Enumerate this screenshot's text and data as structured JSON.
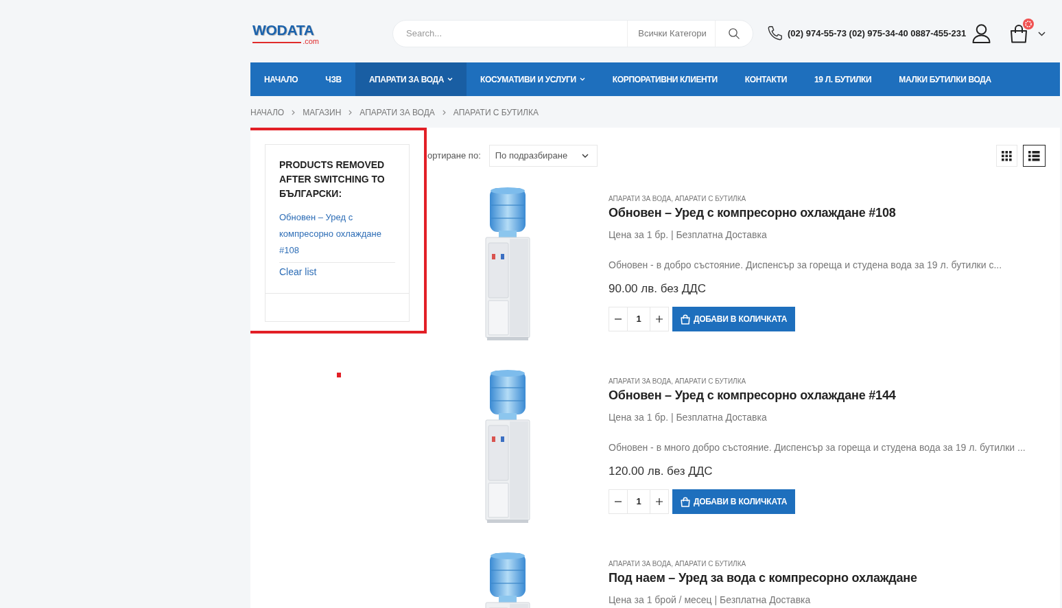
{
  "header": {
    "logo": {
      "wordmark": "WODATA",
      "domain": ".com"
    },
    "search": {
      "placeholder": "Search...",
      "category": "Всички Категори"
    },
    "phones": "(02) 974-55-73 (02) 975-34-40 0887-455-231"
  },
  "nav": [
    {
      "label": "НАЧАЛО",
      "selected": false,
      "has_submenu": false
    },
    {
      "label": "ЧЗВ",
      "selected": false,
      "has_submenu": false
    },
    {
      "label": "АПАРАТИ ЗА ВОДА",
      "selected": true,
      "has_submenu": true
    },
    {
      "label": "КОСУМАТИВИ И УСЛУГИ",
      "selected": false,
      "has_submenu": true
    },
    {
      "label": "КОРПОРАТИВНИ КЛИЕНТИ",
      "selected": false,
      "has_submenu": false
    },
    {
      "label": "КОНТАКТИ",
      "selected": false,
      "has_submenu": false
    },
    {
      "label": "19 Л. БУТИЛКИ",
      "selected": false,
      "has_submenu": false
    },
    {
      "label": "МАЛКИ БУТИЛКИ ВОДА",
      "selected": false,
      "has_submenu": false
    }
  ],
  "breadcrumb": [
    "НАЧАЛО",
    "МАГАЗИН",
    "АПАРАТИ ЗА ВОДА",
    "АПАРАТИ С БУТИЛКА"
  ],
  "sidebar": {
    "title": "PRODUCTS REMOVED AFTER SWITCHING TO БЪЛГАРСКИ:",
    "items": [
      "Обновен – Уред с компресорно охлаждане #108"
    ],
    "clear_link": "Clear list"
  },
  "toolbar": {
    "sort_label": "ортиране по:",
    "sort_value": "По подразбиране",
    "view_modes": [
      {
        "kind": "grid",
        "selected": false
      },
      {
        "kind": "list",
        "selected": true
      }
    ]
  },
  "products": [
    {
      "categories": "АПАРАТИ ЗА ВОДА, АПАРАТИ С БУТИЛКА",
      "title": "Обновен – Уред с компресорно охлаждане #108",
      "subtitle": "Цена за 1 бр. | Безплатна Доставка",
      "description": "Обновен - в добро състояние. Диспенсър за гореща и студена вода за 19 л. бутилки с...",
      "price": "90.00 лв. без ДДС",
      "quantity": "1",
      "button": "ДОБАВИ В КОЛИЧКАТА"
    },
    {
      "categories": "АПАРАТИ ЗА ВОДА, АПАРАТИ С БУТИЛКА",
      "title": "Обновен – Уред с компресорно охлаждане #144",
      "subtitle": "Цена за 1 бр. | Безплатна Доставка",
      "description": "Обновен - в много добро състояние. Диспенсър за гореща и студена вода за 19 л. бутилки ...",
      "price": "120.00 лв. без ДДС",
      "quantity": "1",
      "button": "ДОБАВИ В КОЛИЧКАТА"
    },
    {
      "categories": "АПАРАТИ ЗА ВОДА, АПАРАТИ С БУТИЛКА",
      "title": "Под наем – Уред за вода с компресорно охлаждане",
      "subtitle": "Цена за 1 брой / месец | Безплатна Доставка"
    }
  ]
}
